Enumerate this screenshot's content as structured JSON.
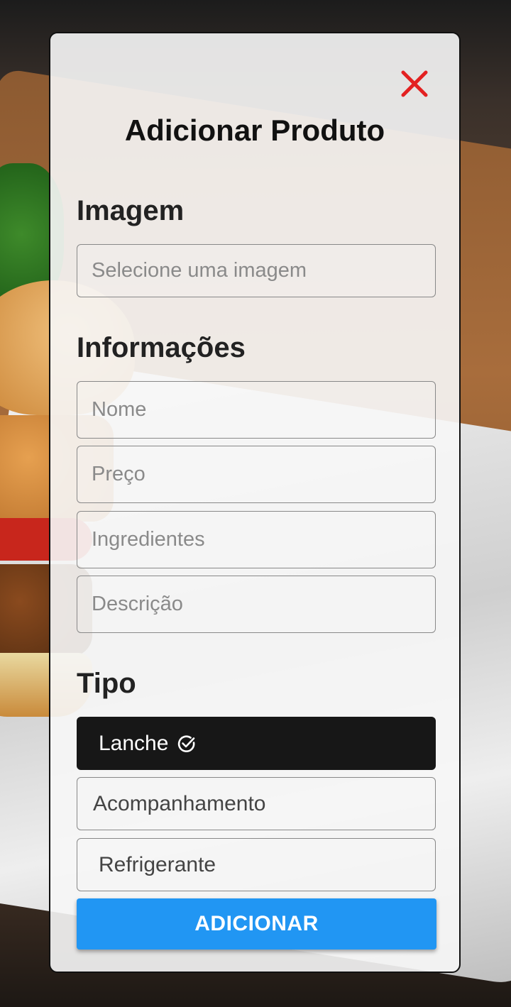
{
  "modal": {
    "title": "Adicionar Produto",
    "close_icon": "close-x-icon",
    "close_color": "#e32121"
  },
  "imagem": {
    "heading": "Imagem",
    "placeholder": "Selecione uma imagem"
  },
  "informacoes": {
    "heading": "Informações",
    "fields": [
      {
        "placeholder": "Nome"
      },
      {
        "placeholder": "Preço"
      },
      {
        "placeholder": "Ingredientes"
      },
      {
        "placeholder": "Descrição"
      }
    ]
  },
  "tipo": {
    "heading": "Tipo",
    "options": [
      {
        "label": "Lanche",
        "selected": true,
        "icon": "check-circle-icon"
      },
      {
        "label": "Acompanhamento",
        "selected": false
      },
      {
        "label": "Refrigerante",
        "selected": false
      }
    ]
  },
  "submit": {
    "label": "ADICIONAR",
    "color": "#2196f3"
  }
}
